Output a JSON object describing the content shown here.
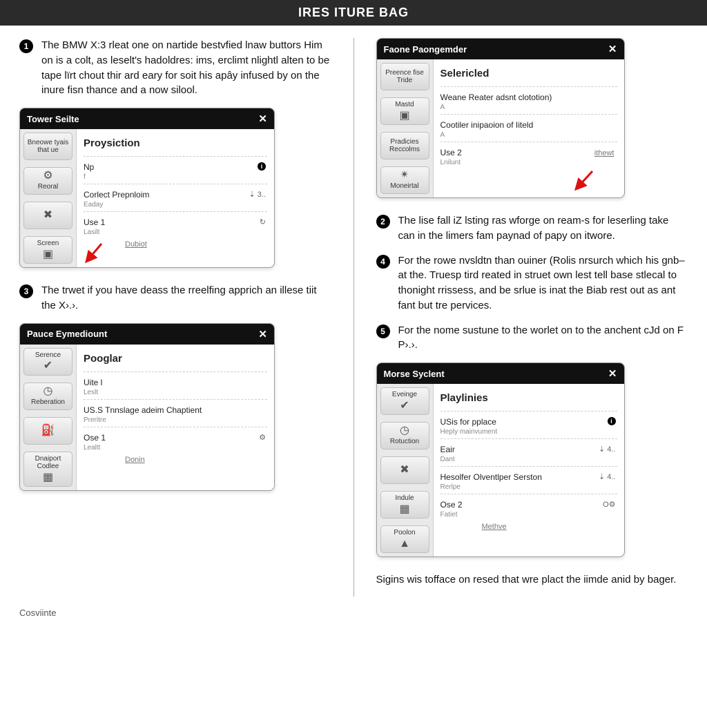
{
  "header": {
    "title": "IRES ITURE BAG"
  },
  "left": {
    "step1": {
      "num": "1",
      "text": "The BMW X:3 rleat one on nartide bestvfied lnaw buttors Him on is a colt, as leselt's hadoldres: ims, erclimt nlightl alten to be tape lïrt chout thir ard eary for soit his apây infused by on the inure fisn thance and a now silool."
    },
    "win1": {
      "title": "Tower Seilte",
      "tabs": [
        {
          "label": "Bneowe tyais that ue"
        },
        {
          "label": "Reoral",
          "icon": "⚙"
        },
        {
          "label": "",
          "icon": "✖"
        },
        {
          "label": "Screen",
          "icon": "▣"
        }
      ],
      "head": "Proysiction",
      "rows": [
        {
          "title": "Np",
          "sub": "f",
          "info": true
        },
        {
          "title": "Corlect Prepnloim",
          "sub": "Eaday",
          "right": "⇣ 3.."
        },
        {
          "title": "Use 1",
          "sub": "Lasilt",
          "link": "Dubiot",
          "rightIcon": "↻"
        }
      ]
    },
    "step3": {
      "num": "3",
      "text": "The trwet if you have deass the rreelfing apprich an illese tiit the X›.›."
    },
    "win3": {
      "title": "Pauce Eymediount",
      "tabs": [
        {
          "label": "Serence",
          "icon": "✔"
        },
        {
          "label": "Reberation",
          "icon": "◷"
        },
        {
          "label": "",
          "icon": "⛽"
        },
        {
          "label": "Dnaiport Codlee",
          "icon": "▦"
        }
      ],
      "head": "Pooglar",
      "rows": [
        {
          "title": "Uite l",
          "sub": "Leslt"
        },
        {
          "title": "US.S Tnnslage adeim Chaptient",
          "sub": "Preritre"
        },
        {
          "title": "Ose 1",
          "sub": "Lealtt",
          "link": "Donin",
          "rightIcon": "⚙"
        }
      ]
    }
  },
  "right": {
    "win2": {
      "title": "Faone Paongemder",
      "tabs": [
        {
          "label": "Preence fise Tride"
        },
        {
          "label": "Mastd",
          "icon": "▣"
        },
        {
          "label": "Pradicies Reccolms"
        },
        {
          "label": "Moneirtal",
          "icon": "✴"
        }
      ],
      "head": "Selericled",
      "rows": [
        {
          "title": "Weane Reater adsnt clototion)",
          "sub": "A"
        },
        {
          "title": "Cootiler inipaoion of Iiteld",
          "sub": "A"
        },
        {
          "title": "Use 2",
          "sub": "Lnilunt",
          "link": "ithewt"
        }
      ]
    },
    "step2": {
      "num": "2",
      "text": "The lise fall iZ lsting ras wforge on ream-s for leserling take can in the limers fam paynad of papy on itwore."
    },
    "step4": {
      "num": "4",
      "text": "For the rowe nvsldtn than ouiner (Rolis nrsurch which his gnb–at the. Truesp tird reated in struet own lest tell base stlecal to thonight rrissess, and be srlue is inat the Biab rest out as ant fant but tre pervices."
    },
    "step5": {
      "num": "5",
      "text": "For the nome sustune to the worlet on to the anchent cJd on F P›.›."
    },
    "win5": {
      "title": "Morse Syclent",
      "tabs": [
        {
          "label": "Eveinge",
          "icon": "✔"
        },
        {
          "label": "Rotuction",
          "icon": "◷"
        },
        {
          "label": "",
          "icon": "✖"
        },
        {
          "label": "Indule",
          "icon": "▦"
        },
        {
          "label": "Poolon",
          "icon": "▲"
        }
      ],
      "head": "Playlinies",
      "rows": [
        {
          "title": "USis for pplace",
          "sub": "Heply mainvument"
        },
        {
          "title": "Eair",
          "sub": "Dant",
          "right": "⇣ 4..",
          "info": true
        },
        {
          "title": "Hesolfer Olventlper Serston",
          "sub": "Rerlpe",
          "right": "⇣ 4.."
        },
        {
          "title": "Ose 2",
          "sub": "Fatiet",
          "link": "Methve",
          "rightIcon": "O⚙"
        }
      ]
    },
    "closing": "Sigins wis tofface on resed that wre plact the iimde anid by bager."
  },
  "footer": "Cosviinte"
}
